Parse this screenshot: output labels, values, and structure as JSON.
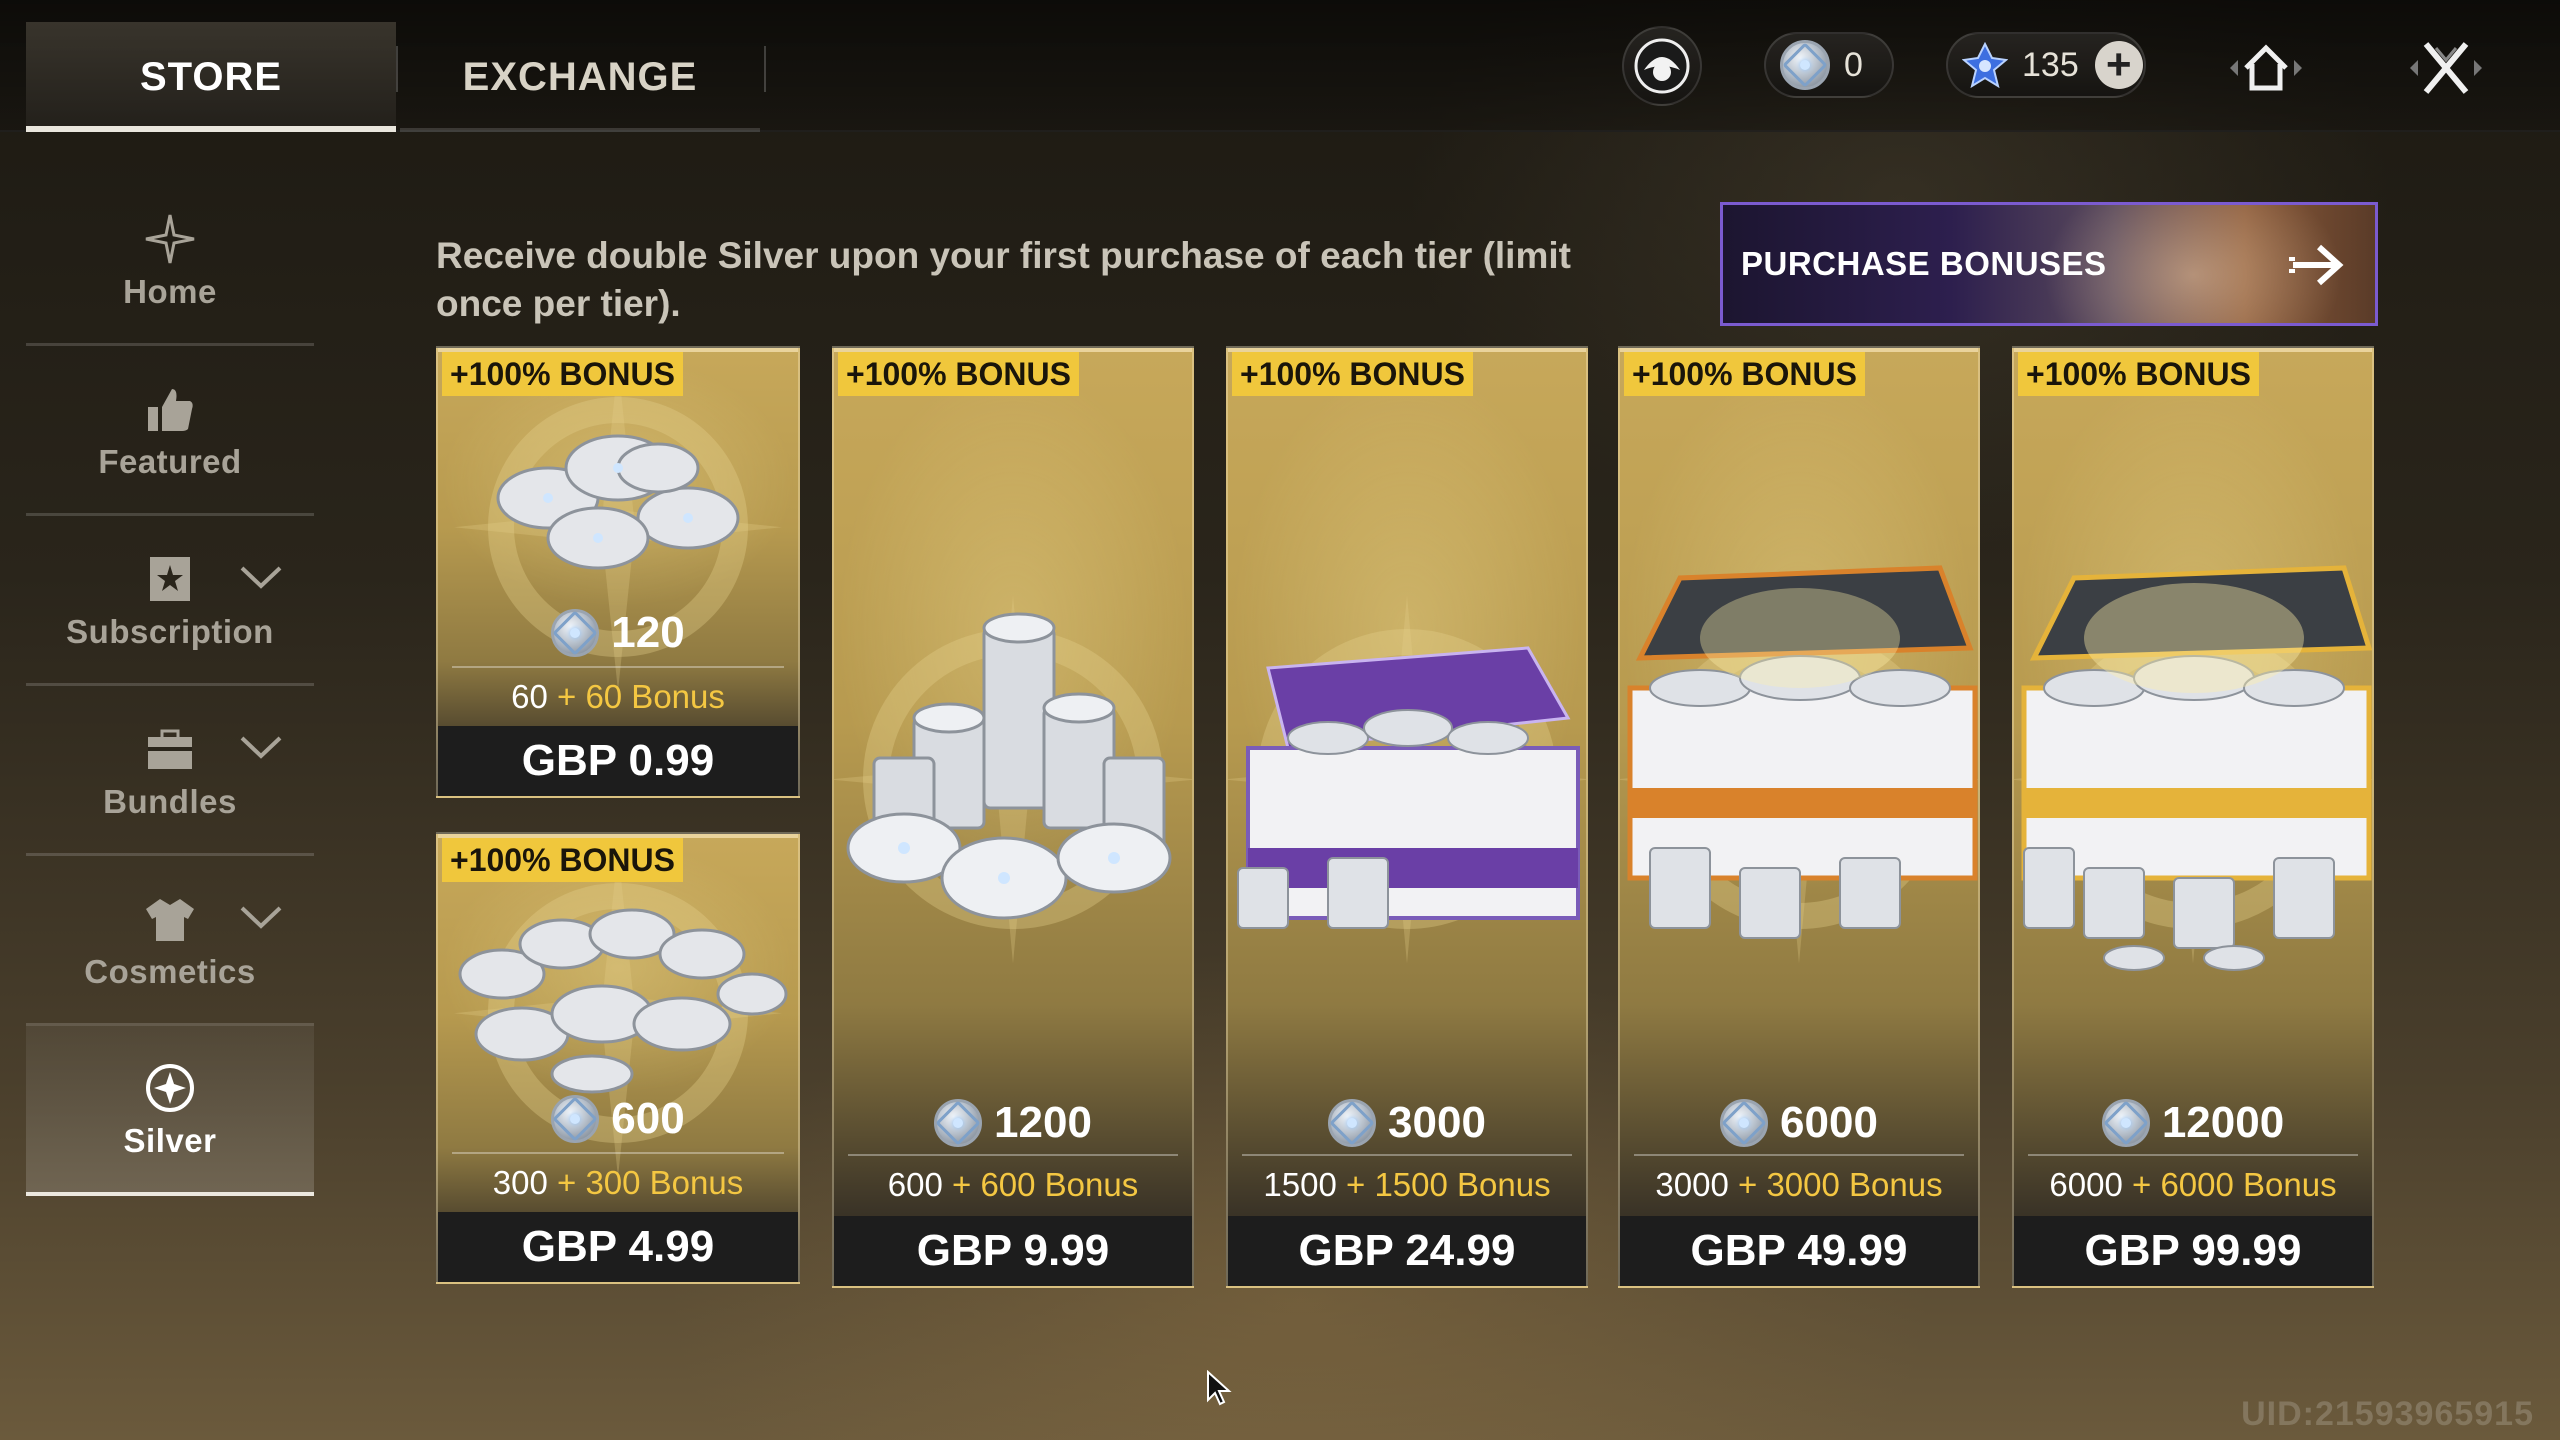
{
  "tabs": [
    {
      "label": "STORE",
      "active": true
    },
    {
      "label": "EXCHANGE",
      "active": false
    }
  ],
  "header": {
    "silver_balance": "0",
    "gem_balance": "135",
    "icons": [
      "profile-icon",
      "silver-coin-icon",
      "gem-icon",
      "plus-icon",
      "home-icon",
      "close-icon"
    ]
  },
  "sidebar": {
    "items": [
      {
        "label": "Home",
        "icon": "sparkle-icon",
        "expandable": false,
        "active": false
      },
      {
        "label": "Featured",
        "icon": "thumbs-up-icon",
        "expandable": false,
        "active": false
      },
      {
        "label": "Subscription",
        "icon": "bookmark-star-icon",
        "expandable": true,
        "active": false
      },
      {
        "label": "Bundles",
        "icon": "box-icon",
        "expandable": true,
        "active": false
      },
      {
        "label": "Cosmetics",
        "icon": "shirt-icon",
        "expandable": true,
        "active": false
      },
      {
        "label": "Silver",
        "icon": "silver-coin-icon",
        "expandable": false,
        "active": true
      }
    ]
  },
  "main": {
    "notice": "Receive double Silver upon your first purchase of each tier (limit once per tier).",
    "bonus_banner": {
      "label": "PURCHASE BONUSES"
    },
    "offers": [
      {
        "badge": "+100% BONUS",
        "amount": "120",
        "base": "60",
        "plus": "+",
        "bonus": "60 Bonus",
        "price": "GBP 0.99"
      },
      {
        "badge": "+100% BONUS",
        "amount": "600",
        "base": "300",
        "plus": "+",
        "bonus": "300 Bonus",
        "price": "GBP 4.99"
      },
      {
        "badge": "+100% BONUS",
        "amount": "1200",
        "base": "600",
        "plus": "+",
        "bonus": "600 Bonus",
        "price": "GBP 9.99"
      },
      {
        "badge": "+100% BONUS",
        "amount": "3000",
        "base": "1500",
        "plus": "+",
        "bonus": "1500 Bonus",
        "price": "GBP 24.99"
      },
      {
        "badge": "+100% BONUS",
        "amount": "6000",
        "base": "3000",
        "plus": "+",
        "bonus": "3000 Bonus",
        "price": "GBP 49.99"
      },
      {
        "badge": "+100% BONUS",
        "amount": "12000",
        "base": "6000",
        "plus": "+",
        "bonus": "6000 Bonus",
        "price": "GBP 99.99"
      }
    ]
  },
  "footer": {
    "uid": "UID:21593965915"
  },
  "colors": {
    "badge": "#f0c73c",
    "bonus_text": "#f4c742",
    "card_gold": "#c7a85a",
    "price_bg": "#1d1d1d",
    "banner_border": "#7b5bd0"
  }
}
